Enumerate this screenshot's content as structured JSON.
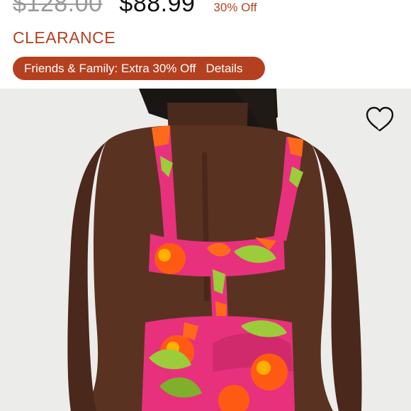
{
  "product": {
    "original_price": "$128.00",
    "sale_price": "$88.99",
    "discount_label": "30% Off",
    "status_label": "CLEARANCE"
  },
  "promo": {
    "text": "Friends & Family: Extra 30% Off",
    "details_label": "Details"
  },
  "image": {
    "description_icon": "product-photo",
    "favorite_icon": "heart-icon"
  },
  "colors": {
    "accent": "#b5401f",
    "price": "#111111",
    "strike_price": "#9a9a9a"
  }
}
